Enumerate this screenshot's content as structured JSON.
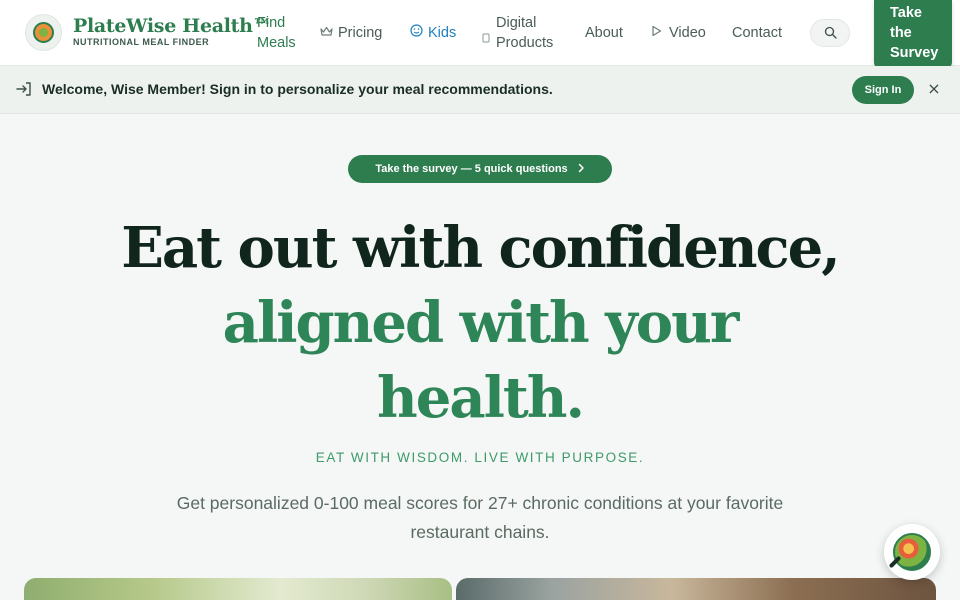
{
  "nav": {
    "brand": "PlateWise Health™",
    "tagline": "NUTRITIONAL MEAL FINDER",
    "links": [
      {
        "label": "Find Meals",
        "icon": "",
        "active": true
      },
      {
        "label": "Pricing",
        "icon": "crown-icon"
      },
      {
        "label": "Kids",
        "icon": "smile-icon",
        "color": "#1f7fc0"
      },
      {
        "label": "Digital Products",
        "icon": "tablet-icon"
      },
      {
        "label": "About",
        "icon": ""
      },
      {
        "label": "Video",
        "icon": "play-icon"
      },
      {
        "label": "Contact",
        "icon": ""
      }
    ],
    "cta": "Take the Survey"
  },
  "welcome": {
    "message": "Welcome, Wise Member! Sign in to personalize your meal recommendations.",
    "signin": "Sign In",
    "close": "×"
  },
  "hero": {
    "pill": "Take the survey — 5 quick questions",
    "line1": "Eat out with confidence,",
    "line2": "aligned with your",
    "line3": "health.",
    "motto": "EAT WITH WISDOM. LIVE WITH PURPOSE.",
    "sub": "Get personalized 0-100 meal scores for 27+ chronic conditions at your favorite restaurant chains."
  },
  "colors": {
    "brand_green": "#2e7d4f",
    "accent_blue": "#1f7fc0",
    "dark_heading": "#10261c"
  }
}
